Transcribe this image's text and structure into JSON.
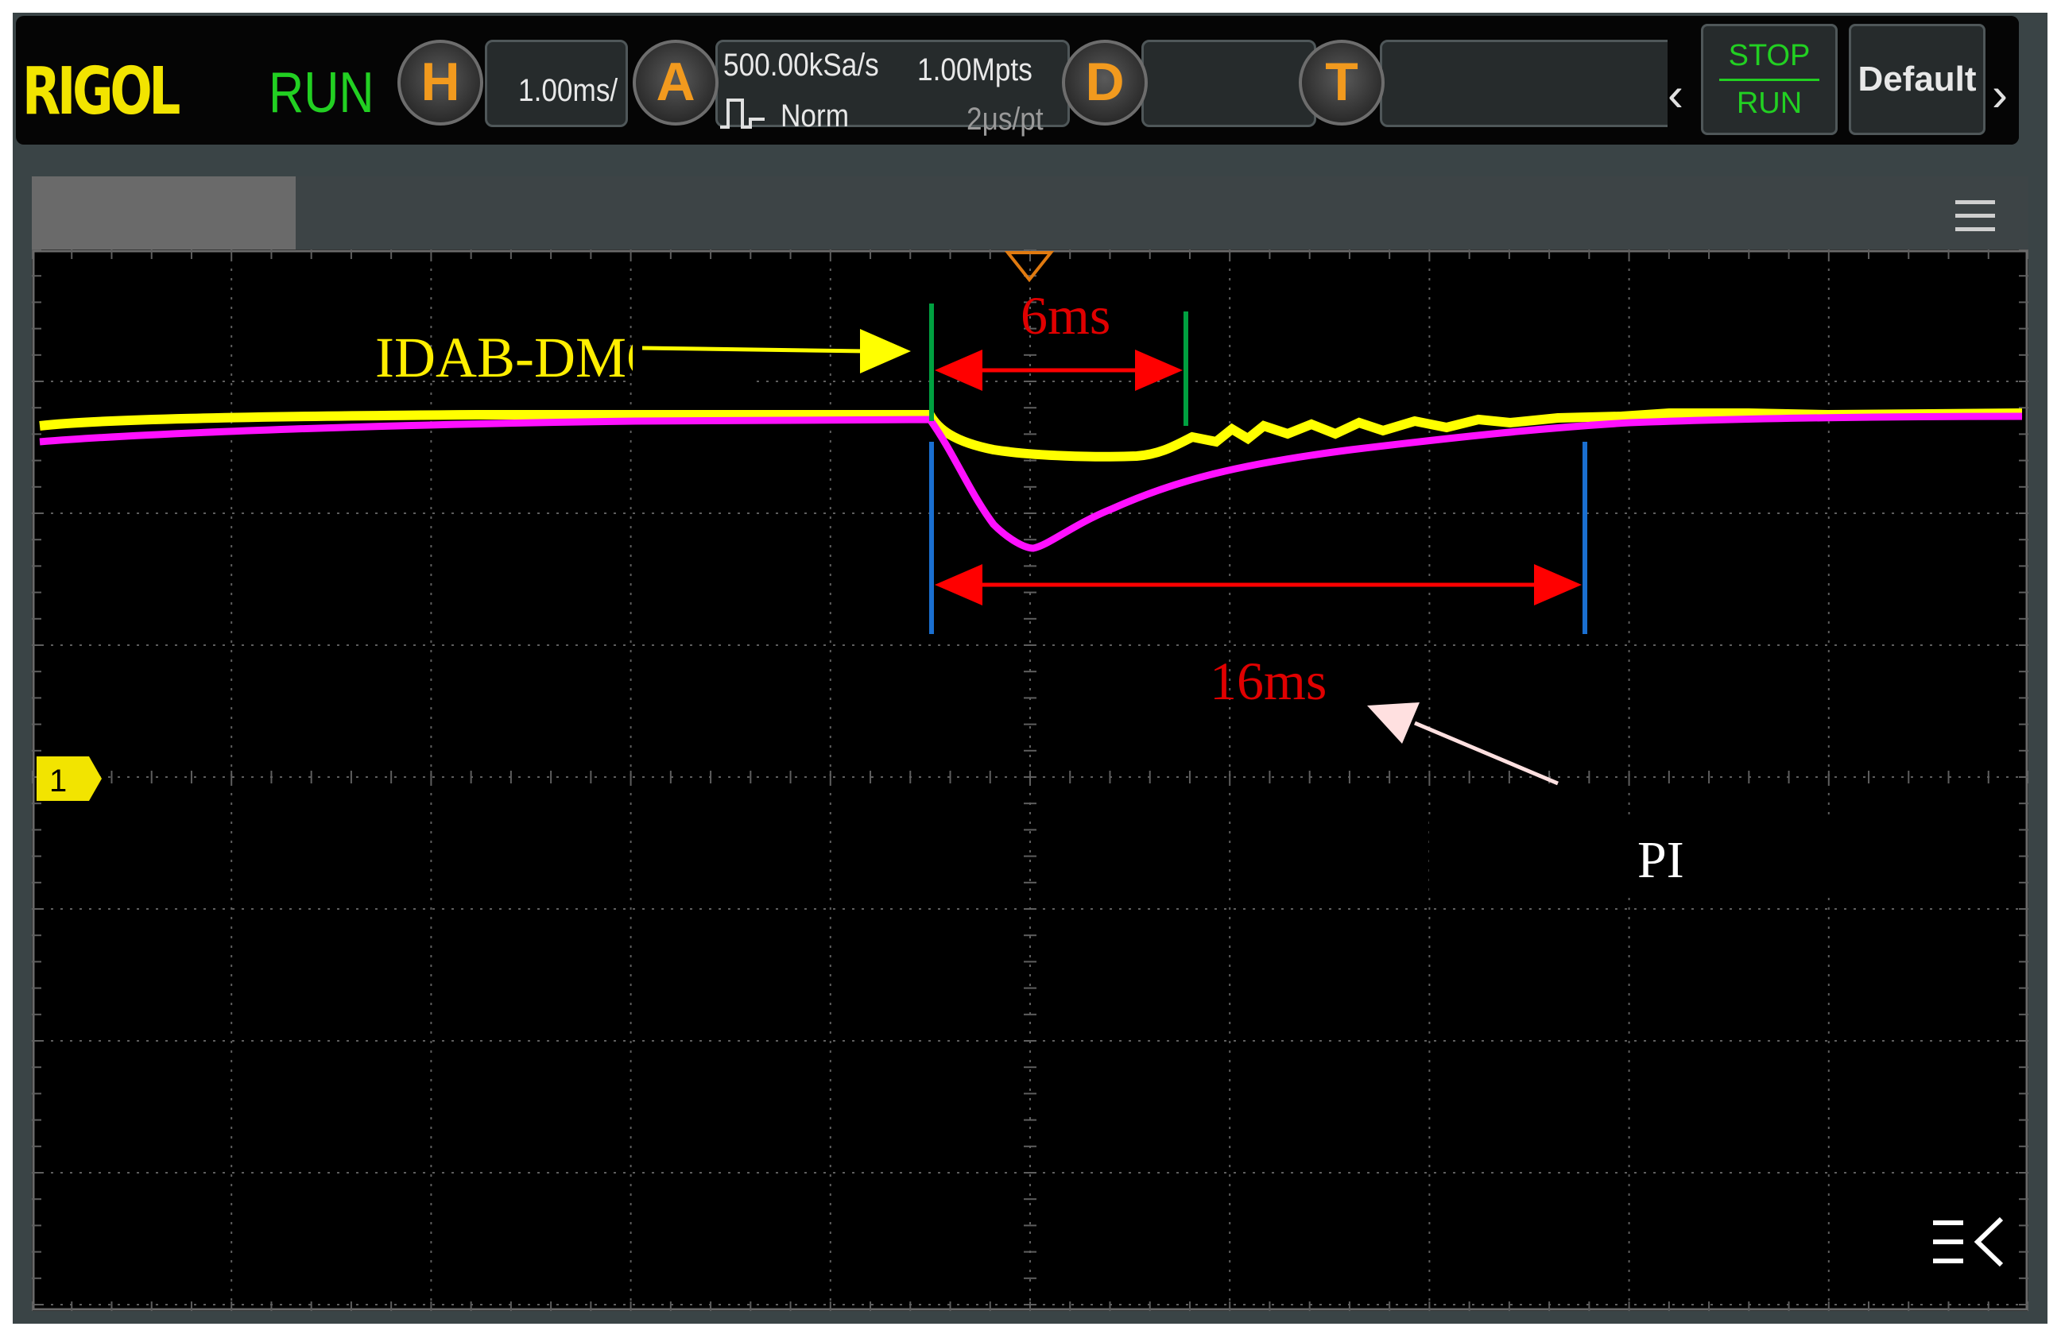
{
  "topbar": {
    "brand": "RIGOL",
    "run_status": "RUN",
    "horizontal": {
      "key": "H",
      "scale": "1.00ms/"
    },
    "acquire": {
      "key": "A",
      "sample_rate": "500.00kSa/s",
      "memory_depth": "1.00Mpts",
      "mode": "Norm",
      "time_per_point": "2μs/pt"
    },
    "display": {
      "key": "D"
    },
    "trigger": {
      "key": "T"
    },
    "stop_label": "STOP",
    "run_label": "RUN",
    "default_label": "Default",
    "colors": {
      "brand": "#f2e400",
      "run": "#22d022",
      "knob_letter": "#f29a1e"
    }
  },
  "screen": {
    "channel_marker": "1",
    "annotations": {
      "idab_dmc": "IDAB-DMC",
      "short_duration": "6ms",
      "long_duration": "16ms",
      "pi": "PI"
    },
    "colors": {
      "idab_dmc_trace": "#ffff00",
      "pi_trace": "#ff00ff",
      "measure_arrow": "#ff0000",
      "bracket_short": "#00a040",
      "bracket_long": "#1a6fd0",
      "pi_pointer": "#ffe0e0",
      "grid": "#606060"
    }
  },
  "icons": [
    "hamburger-menu-icon",
    "waveform-pulse-icon",
    "trigger-marker-icon",
    "chevron-left-icon",
    "chevron-right-icon",
    "collapse-panel-icon"
  ]
}
